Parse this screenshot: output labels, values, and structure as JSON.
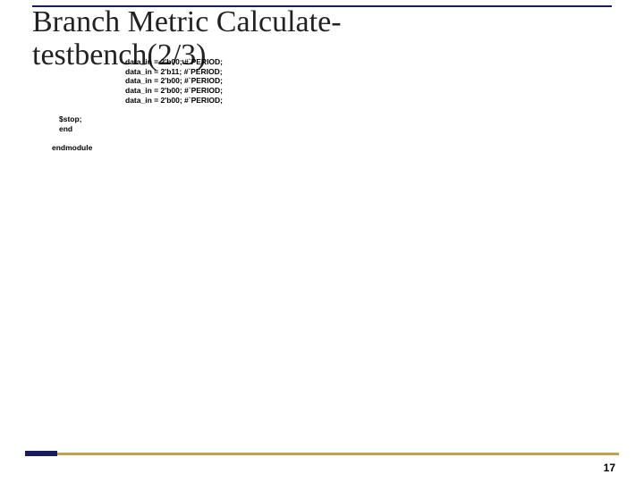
{
  "title_line1": "Branch Metric Calculate-",
  "title_line2": "testbench(2/3)",
  "code_lines": {
    "l0": "data_in = 2'b00; #`PERIOD;",
    "l1": "data_in = 2'b11; #`PERIOD;",
    "l2": "data_in = 2'b00; #`PERIOD;",
    "l3": "data_in = 2'b00; #`PERIOD;",
    "l4": "data_in = 2'b00; #`PERIOD;"
  },
  "stop": {
    "s0": "$stop;",
    "s1": "end"
  },
  "endmodule": "endmodule",
  "page_number": "17"
}
